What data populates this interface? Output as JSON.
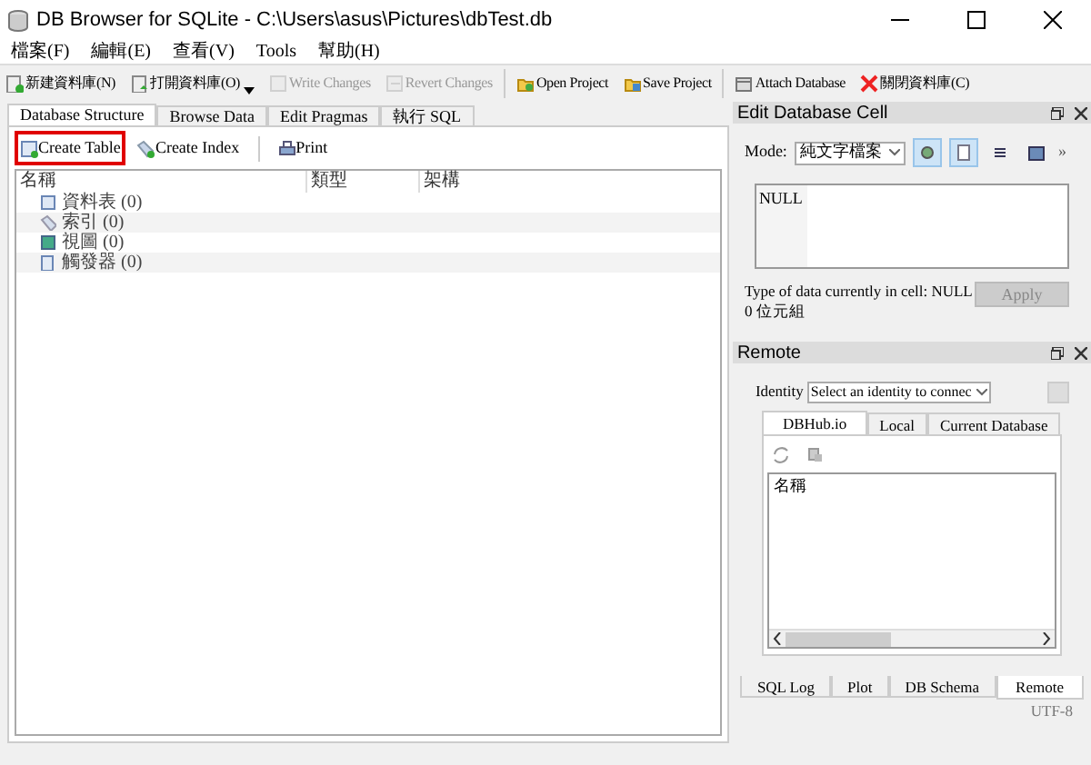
{
  "window": {
    "title": "DB Browser for SQLite - C:\\Users\\asus\\Pictures\\dbTest.db"
  },
  "menu": [
    "檔案(F)",
    "編輯(E)",
    "查看(V)",
    "Tools",
    "幫助(H)"
  ],
  "toolbar": [
    [
      {
        "label": "新建資料庫(N)",
        "kind": "new",
        "disabled": false
      },
      {
        "label": "打開資料庫(O)",
        "kind": "open",
        "disabled": false,
        "dropdown": true
      },
      {
        "label": "Write Changes",
        "kind": "write",
        "disabled": true
      },
      {
        "label": "Revert Changes",
        "kind": "revert",
        "disabled": true
      }
    ],
    [
      {
        "label": "Open Project",
        "kind": "project",
        "disabled": false
      },
      {
        "label": "Save Project",
        "kind": "save",
        "disabled": false
      }
    ],
    [
      {
        "label": "Attach Database",
        "kind": "attach",
        "disabled": false
      },
      {
        "label": "關閉資料庫(C)",
        "kind": "close",
        "disabled": false
      }
    ]
  ],
  "tabs": [
    {
      "label": "Database Structure",
      "selected": true
    },
    {
      "label": "Browse Data",
      "selected": false
    },
    {
      "label": "Edit Pragmas",
      "selected": false
    },
    {
      "label": "執行 SQL",
      "selected": false
    }
  ],
  "structure_toolbar": [
    {
      "label": "Create Table",
      "kind": "table",
      "highlighted": true
    },
    {
      "label": "Create Index",
      "kind": "index",
      "highlighted": false
    },
    {
      "label": "Print",
      "kind": "print",
      "highlighted": false
    }
  ],
  "tree": {
    "columns": [
      "名稱",
      "類型",
      "架構"
    ],
    "rows": [
      {
        "label": "資料表 (0)",
        "kind": "table"
      },
      {
        "label": "索引 (0)",
        "kind": "index"
      },
      {
        "label": "視圖 (0)",
        "kind": "view"
      },
      {
        "label": "觸發器 (0)",
        "kind": "trigger"
      }
    ]
  },
  "edit_cell": {
    "title": "Edit Database Cell",
    "mode_label": "Mode:",
    "mode": "純文字檔案",
    "mode_buttons": [
      {
        "kind": "auto",
        "selected": true
      },
      {
        "kind": "text",
        "selected": true
      },
      {
        "kind": "format",
        "selected": false
      },
      {
        "kind": "import",
        "selected": false
      }
    ],
    "more": "»",
    "value": "NULL",
    "type_info": "Type of data currently in cell: NULL",
    "size": "0 位元組",
    "apply": "Apply"
  },
  "remote": {
    "title": "Remote",
    "identity_label": "Identity",
    "identity": "Select an identity to connec",
    "tabs": [
      {
        "label": "DBHub.io",
        "selected": true
      },
      {
        "label": "Local",
        "selected": false
      },
      {
        "label": "Current Database",
        "selected": false
      }
    ],
    "list_header": "名稱"
  },
  "dock_tabs": [
    {
      "label": "SQL Log",
      "selected": false
    },
    {
      "label": "Plot",
      "selected": false
    },
    {
      "label": "DB Schema",
      "selected": false
    },
    {
      "label": "Remote",
      "selected": true
    }
  ],
  "status_bar": {
    "encoding": "UTF-8"
  }
}
